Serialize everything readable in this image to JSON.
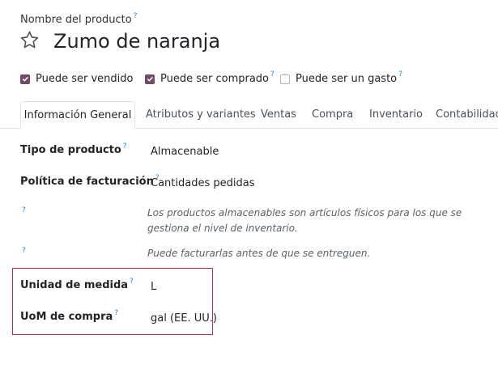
{
  "header": {
    "field_label": "Nombre del producto",
    "product_name": "Zumo de naranja"
  },
  "help_mark": "?",
  "checkboxes": [
    {
      "label": "Puede ser vendido",
      "checked": true
    },
    {
      "label": "Puede ser comprado",
      "checked": true
    },
    {
      "label": "Puede ser un gasto",
      "checked": false
    }
  ],
  "tabs": [
    {
      "label": "Información General",
      "active": true
    },
    {
      "label": "Atributos y variantes"
    },
    {
      "label": "Ventas"
    },
    {
      "label": "Compra"
    },
    {
      "label": "Inventario"
    },
    {
      "label": "Contabilidad"
    }
  ],
  "fields": {
    "product_type": {
      "label": "Tipo de producto",
      "value": "Almacenable"
    },
    "invoice_policy": {
      "label": "Política de facturación",
      "value": "Cantidades pedidas"
    },
    "uom": {
      "label": "Unidad de medida",
      "value": "L"
    },
    "purchase_uom": {
      "label": "UoM de compra",
      "value": "gal (EE. UU.)"
    }
  },
  "help_texts": {
    "product_type_help": "Los productos almacenables son artículos físicos para los que se gestiona el nivel de inventario.",
    "invoice_help": "Puede facturarlas antes de que se entreguen."
  },
  "colors": {
    "accent": "#714b67",
    "help_mark": "#1f8fd6",
    "highlight_border": "#c5283d"
  }
}
